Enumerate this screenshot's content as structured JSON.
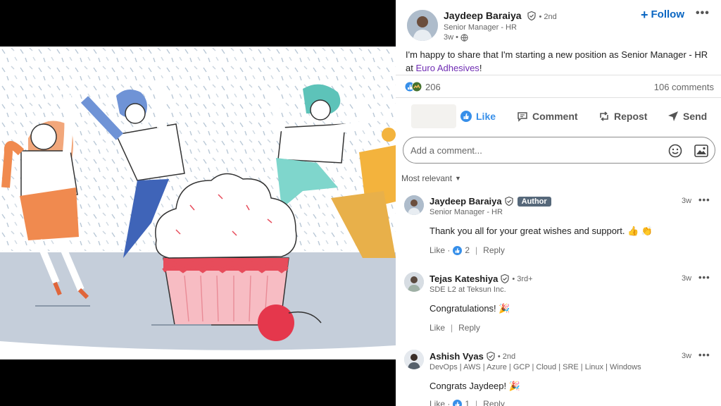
{
  "post": {
    "author_name": "Jaydeep Baraiya",
    "author_degree": "• 2nd",
    "author_title": "Senior Manager - HR",
    "time": "3w •",
    "follow_label": "Follow",
    "more_label": "•••",
    "text_before": "I'm happy to share that I'm starting a new position as Senior Manager - HR at ",
    "text_link": "Euro Adhesives",
    "text_after": "!",
    "reactions_count": "206",
    "comments_count": "106 comments"
  },
  "actions": {
    "like": "Like",
    "comment": "Comment",
    "repost": "Repost",
    "send": "Send"
  },
  "comment_box": {
    "placeholder": "Add a comment..."
  },
  "sort": {
    "label": "Most relevant"
  },
  "comments": [
    {
      "name": "Jaydeep Baraiya",
      "badge": "Author",
      "title": "Senior Manager - HR",
      "time": "3w",
      "text": "Thank you all for your great wishes and support. 👍 👏",
      "like": "Like ·",
      "like_count": "2",
      "sep": "|",
      "reply": "Reply"
    },
    {
      "name": "Tejas Kateshiya",
      "degree": "• 3rd+",
      "title": "SDE L2 at Teksun Inc.",
      "time": "3w",
      "text": "Congratulations! 🎉",
      "like": "Like",
      "sep": "|",
      "reply": "Reply"
    },
    {
      "name": "Ashish Vyas",
      "degree": "• 2nd",
      "title": "DevOps | AWS | Azure | GCP | Cloud | SRE | Linux | Windows",
      "time": "3w",
      "text": "Congrats Jaydeep! 🎉",
      "like": "Like ·",
      "like_count": "1",
      "sep": "|",
      "reply": "Reply"
    }
  ],
  "colors": {
    "brand_blue": "#0a66c2",
    "link_purple": "#6f2cb3",
    "author_badge": "#56687a"
  }
}
